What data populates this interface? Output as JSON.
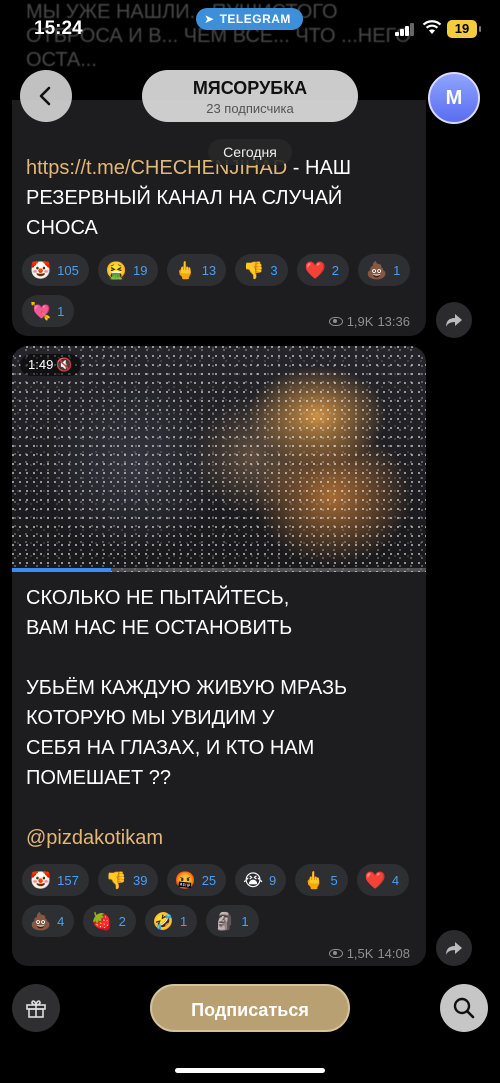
{
  "status_bar": {
    "time": "15:24",
    "telegram_pill": "TELEGRAM",
    "battery": "19",
    "battery_color": "#f5cb40"
  },
  "ghost_text": "МЫ УЖЕ НАШЛИ... ПУШИСТОГО ОТБРОСА И В... ЧЕМ ВСЕ... ЧТО ...НЕГО ОСТА...",
  "header": {
    "back_icon": "chevron-left-icon",
    "channel_name": "МЯСОРУБКА",
    "subscribers": "23 подписчика",
    "avatar_letter": "M",
    "avatar_color": "#6f80f5"
  },
  "date_separator": "Сегодня",
  "messages": [
    {
      "link": "https://t.me/CHECHENJIHAD",
      "text_after_link": " - НАШ",
      "lines": [
        "РЕЗЕРВНЫЙ КАНАЛ НА СЛУЧАЙ",
        "СНОСА"
      ],
      "reactions": [
        {
          "emoji": "🤡",
          "count": "105"
        },
        {
          "emoji": "🤮",
          "count": "19"
        },
        {
          "emoji": "🖕",
          "count": "13"
        },
        {
          "emoji": "👎",
          "count": "3"
        },
        {
          "emoji": "❤️",
          "count": "2"
        },
        {
          "emoji": "💩",
          "count": "1"
        },
        {
          "emoji": "💘",
          "count": "1"
        }
      ],
      "views": "1,9K",
      "time": "13:36"
    },
    {
      "video": {
        "duration": "1:49",
        "muted_icon": "speaker-muted-icon",
        "progress": 0.24
      },
      "lines": [
        "СКОЛЬКО НЕ ПЫТАЙТЕСЬ,",
        "ВАМ НАС НЕ ОСТАНОВИТЬ",
        "",
        "УБЬЁМ КАЖДУЮ ЖИВУЮ МРАЗЬ",
        "КОТОРУЮ МЫ УВИДИМ У",
        "СЕБЯ НА ГЛАЗАХ, И КТО НАМ",
        "ПОМЕШАЕТ ??",
        "",
        "@pizdakotikam"
      ],
      "mention": "@pizdakotikam",
      "reactions": [
        {
          "emoji": "🤡",
          "count": "157"
        },
        {
          "emoji": "👎",
          "count": "39"
        },
        {
          "emoji": "🤬",
          "count": "25"
        },
        {
          "emoji": "😭",
          "count": "9"
        },
        {
          "emoji": "🖕",
          "count": "5"
        },
        {
          "emoji": "❤️",
          "count": "4"
        },
        {
          "emoji": "💩",
          "count": "4"
        },
        {
          "emoji": "🍓",
          "count": "2"
        },
        {
          "emoji": "🤣",
          "count": "1"
        },
        {
          "emoji": "🗿",
          "count": "1"
        }
      ],
      "views": "1,5K",
      "time": "14:08"
    }
  ],
  "bottom": {
    "gift_icon": "gift-icon",
    "subscribe_label": "Подписаться",
    "subscribe_color": "#b9a072",
    "search_icon": "search-icon"
  }
}
